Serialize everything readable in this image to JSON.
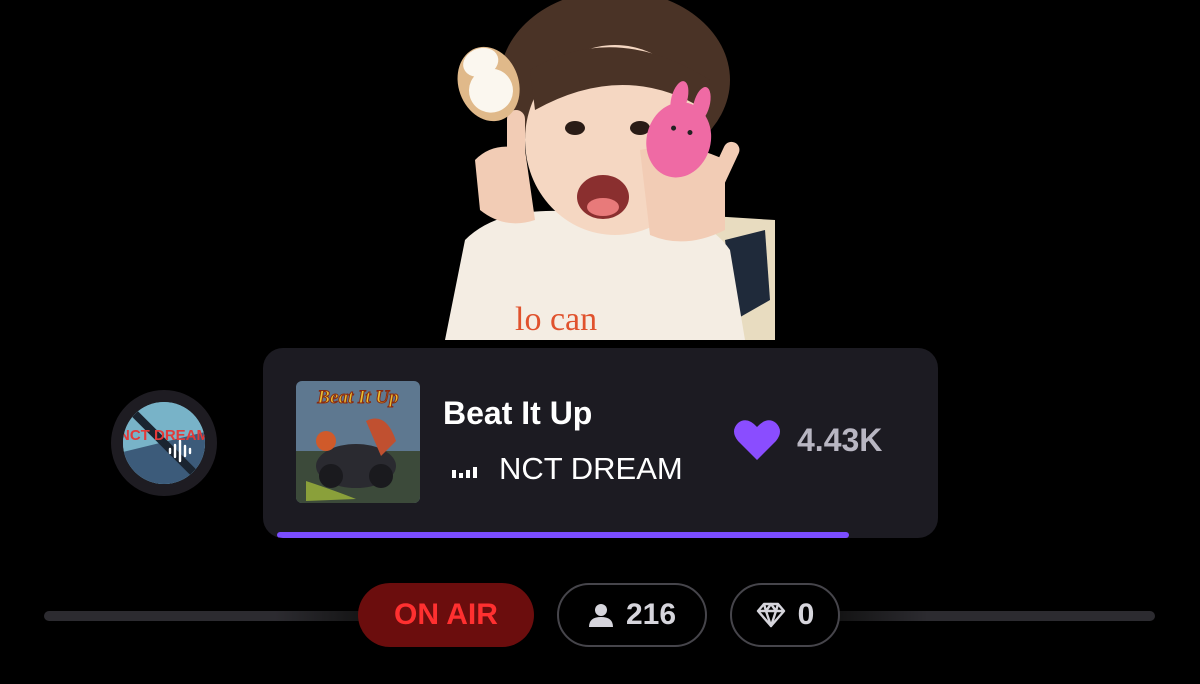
{
  "now_playing": {
    "title": "Beat It Up",
    "artist": "NCT DREAM",
    "likes": "4.43K",
    "progress": 0.88,
    "album_art_text": "Beat It Up",
    "station_avatar_text": "NCT DREAM"
  },
  "status": {
    "on_air_label": "ON AIR",
    "listener_count": "216",
    "gem_count": "0"
  },
  "colors": {
    "accent": "#7b4dff",
    "heart": "#8a4dff",
    "on_air_bg": "#6b0d0d",
    "on_air_text": "#ff3030",
    "card_bg": "#1c1b22"
  },
  "icons": {
    "audio_bars": "audio-bars-icon",
    "heart": "heart-icon",
    "person": "person-icon",
    "diamond": "diamond-icon",
    "sound_wave": "sound-wave-icon"
  }
}
